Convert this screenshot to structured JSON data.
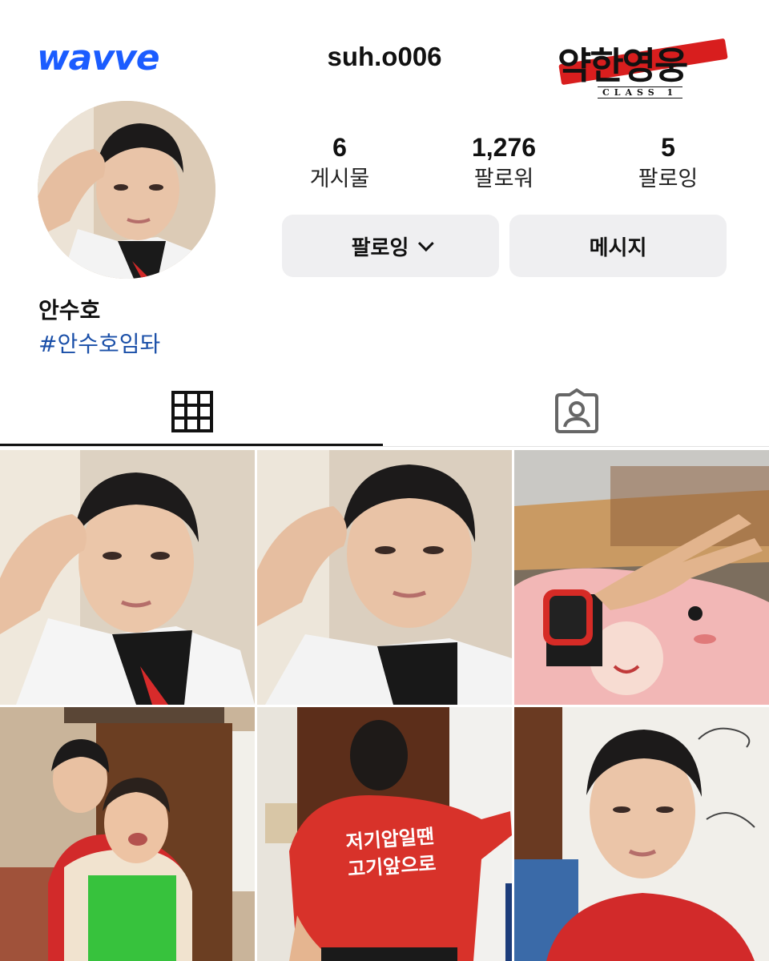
{
  "header": {
    "left_logo_text": "wavve",
    "username": "suh.o006",
    "show_logo": {
      "title": "약한영웅",
      "subtitle": "CLASS 1"
    }
  },
  "profile": {
    "name": "안수호",
    "bio_hashtag": "#안수호임돠",
    "stats": [
      {
        "value": "6",
        "label": "게시물"
      },
      {
        "value": "1,276",
        "label": "팔로워"
      },
      {
        "value": "5",
        "label": "팔로잉"
      }
    ],
    "buttons": {
      "following": "팔로잉",
      "message": "메시지"
    }
  },
  "tabs": [
    {
      "name": "grid",
      "icon": "grid-icon",
      "active": true
    },
    {
      "name": "tagged",
      "icon": "tagged-person-icon",
      "active": false
    }
  ],
  "posts": [
    {
      "desc": "selfie-school-uniform-1"
    },
    {
      "desc": "selfie-school-uniform-2"
    },
    {
      "desc": "peace-sign-red-watch"
    },
    {
      "desc": "with-woman-green-apron"
    },
    {
      "text_on_shirt": [
        "저기압일땐",
        "고기앞으로"
      ]
    },
    {
      "desc": "selfie-red-shirt"
    }
  ],
  "colors": {
    "brand_blue": "#1b5cff",
    "hashtag": "#1a4fa8",
    "button_bg": "#efeff1",
    "logo_red": "#d81e1e"
  }
}
